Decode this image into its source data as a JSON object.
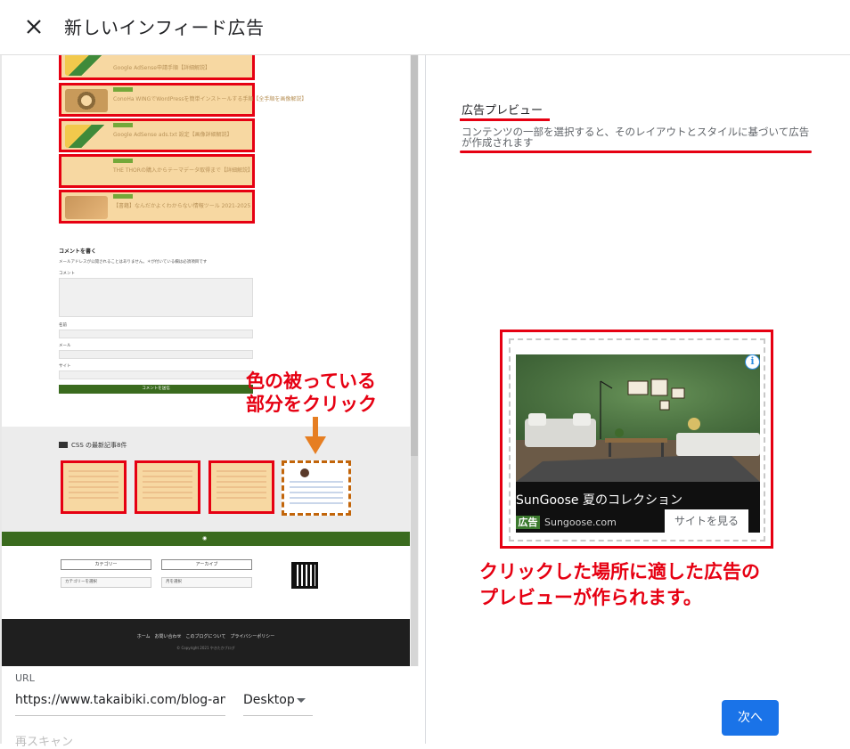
{
  "header": {
    "title": "新しいインフィード広告",
    "close_icon": "close-icon"
  },
  "site_preview": {
    "related_posts": [
      "Google AdSense申請手順【詳細解説】",
      "ConoHa WINGでWordPressを簡単インストールする手順【全手順を画像解説】",
      "Google AdSense ads.txt 設定【画像詳細解説】",
      "THE THORの購入からテーマデータ取得まで【詳細解説】",
      "【書籍】なんだかよくわからない情報ツール 2021-2025"
    ],
    "comment": {
      "title": "コメントを書く",
      "note": "メールアドレスが公開されることはありません。＊が付いている欄は必須項目です",
      "comment_label": "コメント",
      "name_label": "名前",
      "email_label": "メール",
      "site_label": "サイト",
      "submit": "コメントを送信"
    },
    "css_heading": "CSS の最新記事8件",
    "widget_category": "カテゴリー",
    "widget_archive": "アーカイブ",
    "category_select": "カテゴリーを選択",
    "archive_select": "月を選択",
    "footer_links": "ホーム　お問い合わせ　このブログについて　プライバシーポリシー",
    "footer_copy": "© Copyright 2021 やきたかブログ"
  },
  "annotation_left": {
    "line1": "色の被っている",
    "line2": "部分をクリック"
  },
  "url_section": {
    "label": "URL",
    "value": "https://www.takaibiki.com/blog-ameb",
    "device": "Desktop",
    "rescan": "再スキャン"
  },
  "preview": {
    "label": "広告プレビュー",
    "description": "コンテンツの一部を選択すると、そのレイアウトとスタイルに基づいて広告が作成されます"
  },
  "ad": {
    "title": "SunGoose 夏のコレクション",
    "badge": "広告",
    "domain": "Sungoose.com",
    "cta": "サイトを見る",
    "info_icon": "info-icon"
  },
  "annotation_right": {
    "line1": "クリックした場所に適した広告の",
    "line2": "プレビューが作られます。"
  },
  "footer": {
    "next": "次へ"
  },
  "colors": {
    "highlight_red": "#e60012",
    "annotation_orange": "#e67e22",
    "primary_blue": "#1a73e8",
    "site_green": "#3a6b1e"
  }
}
